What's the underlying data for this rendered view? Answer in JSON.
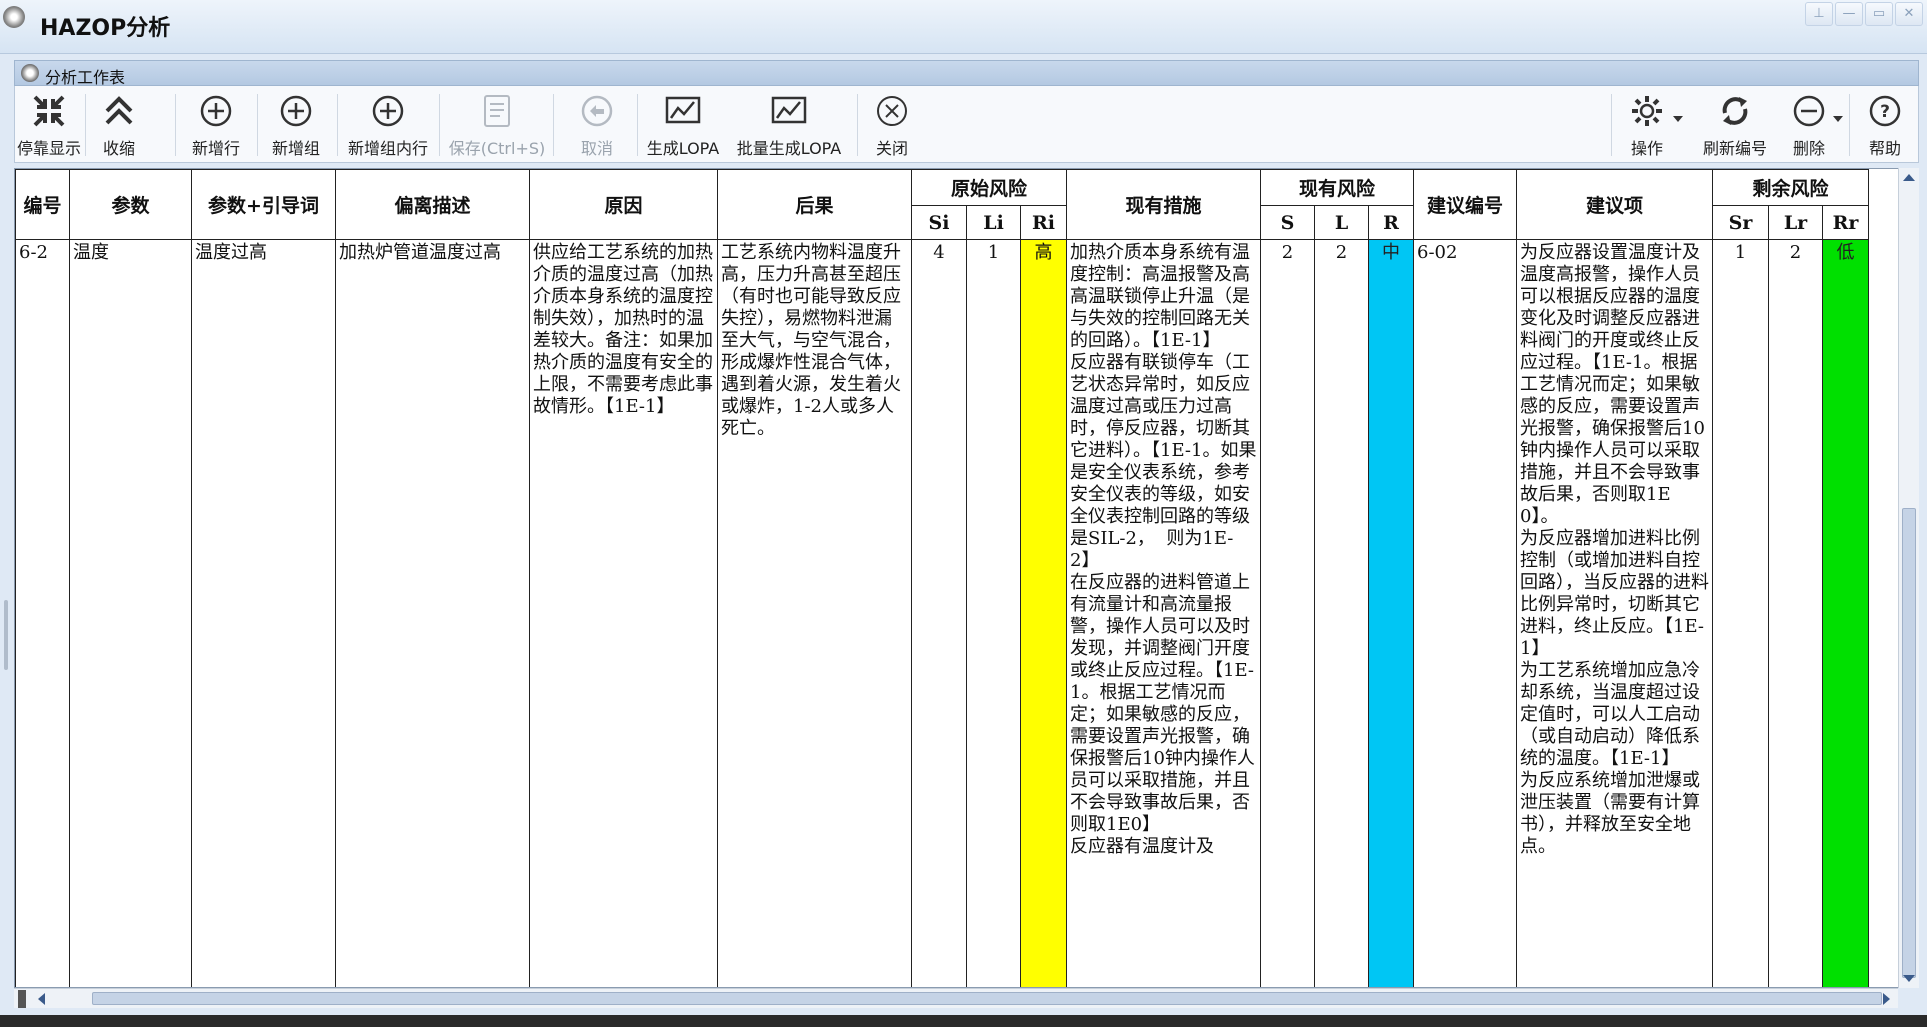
{
  "window": {
    "title": "HAZOP分析"
  },
  "panel": {
    "title": "分析工作表"
  },
  "toolbar": {
    "dock": "停靠显示",
    "collapse": "收缩",
    "add_row": "新增行",
    "add_group": "新增组",
    "add_group_row": "新增组内行",
    "save": "保存(Ctrl+S)",
    "cancel": "取消",
    "gen_lopa": "生成LOPA",
    "batch_lopa": "批量生成LOPA",
    "close": "关闭",
    "operate": "操作",
    "refresh_num": "刷新编号",
    "delete": "删除",
    "help": "帮助"
  },
  "table": {
    "headers": {
      "num": "编号",
      "param": "参数",
      "param_guide": "参数+引导词",
      "deviation": "偏离描述",
      "cause": "原因",
      "consequence": "后果",
      "orig_risk": "原始风险",
      "measures": "现有措施",
      "curr_risk": "现有风险",
      "sugg_num": "建议编号",
      "suggestion": "建议项",
      "resid_risk": "剩余风险",
      "si": "Si",
      "li": "Li",
      "ri": "Ri",
      "s": "S",
      "l": "L",
      "r": "R",
      "sr": "Sr",
      "lr": "Lr",
      "rr": "Rr"
    },
    "row": {
      "num": "6-2",
      "param": "温度",
      "param_guide": "温度过高",
      "deviation": "加热炉管道温度过高",
      "cause": "供应给工艺系统的加热介质的温度过高（加热介质本身系统的温度控制失效），加热时的温差较大。备注：如果加热介质的温度有安全的上限，不需要考虑此事故情形。【1E-1】",
      "consequence": "工艺系统内物料温度升高，压力升高甚至超压（有时也可能导致反应失控），易燃物料泄漏至大气，与空气混合，形成爆炸性混合气体，遇到着火源，发生着火或爆炸，1-2人或多人死亡。",
      "si": "4",
      "li": "1",
      "ri": "高",
      "measures": "加热介质本身系统有温度控制：高温报警及高高温联锁停止升温（是与失效的控制回路无关的回路）。【1E-1】\n反应器有联锁停车（工艺状态异常时，如反应温度过高或压力过高时，停反应器，切断其它进料）。【1E-1。如果是安全仪表系统，参考安全仪表的等级，如安全仪表控制回路的等级是SIL-2，  则为1E-2】\n在反应器的进料管道上有流量计和高流量报警，操作人员可以及时发现，并调整阀门开度或终止反应过程。【1E-1。根据工艺情况而定；如果敏感的反应，需要设置声光报警，确保报警后10钟内操作人员可以采取措施，并且不会导致事故后果，否则取1E0】\n反应器有温度计及",
      "s": "2",
      "l": "2",
      "r": "中",
      "sugg_num": "6-02",
      "suggestion": "为反应器设置温度计及温度高报警，操作人员可以根据反应器的温度变化及时调整反应器进料阀门的开度或终止反应过程。【1E-1。根据工艺情况而定；如果敏感的反应，需要设置声光报警，确保报警后10钟内操作人员可以采取措施，并且不会导致事故后果，否则取1E0】。\n为反应器增加进料比例控制（或增加进料自控回路），当反应器的进料比例异常时，切断其它进料，终止反应。【1E-1】\n为工艺系统增加应急冷却系统，当温度超过设定值时，可以人工启动（或自动启动）降低系统的温度。【1E-1】\n为反应系统增加泄爆或泄压装置（需要有计算书），并释放至安全地点。",
      "sr": "1",
      "lr": "2",
      "rr": "低"
    }
  }
}
